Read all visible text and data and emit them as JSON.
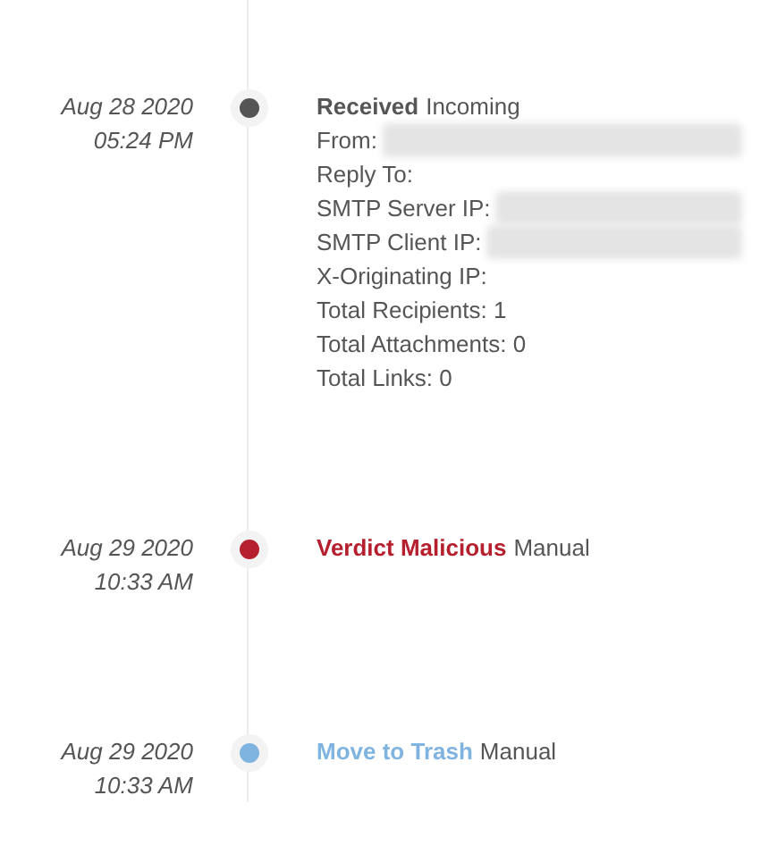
{
  "events": [
    {
      "date": "Aug 28 2020",
      "time": "05:24 PM",
      "title": "Received",
      "subtitle": "Incoming",
      "color": "#555555",
      "details": [
        {
          "label": "From:",
          "redacted": true
        },
        {
          "label": "Reply To:",
          "redacted": false
        },
        {
          "label": "SMTP Server IP:",
          "redacted": true
        },
        {
          "label": "SMTP Client IP:",
          "redacted": true
        },
        {
          "label": "X-Originating IP:",
          "redacted": false
        },
        {
          "label": "Total Recipients: 1",
          "redacted": false
        },
        {
          "label": "Total Attachments: 0",
          "redacted": false
        },
        {
          "label": "Total Links: 0",
          "redacted": false
        }
      ]
    },
    {
      "date": "Aug 29 2020",
      "time": "10:33 AM",
      "title": "Verdict Malicious",
      "subtitle": "Manual",
      "color": "#b51f2e"
    },
    {
      "date": "Aug 29 2020",
      "time": "10:33 AM",
      "title": "Move to Trash",
      "subtitle": "Manual",
      "color": "#7fb3e0"
    }
  ]
}
